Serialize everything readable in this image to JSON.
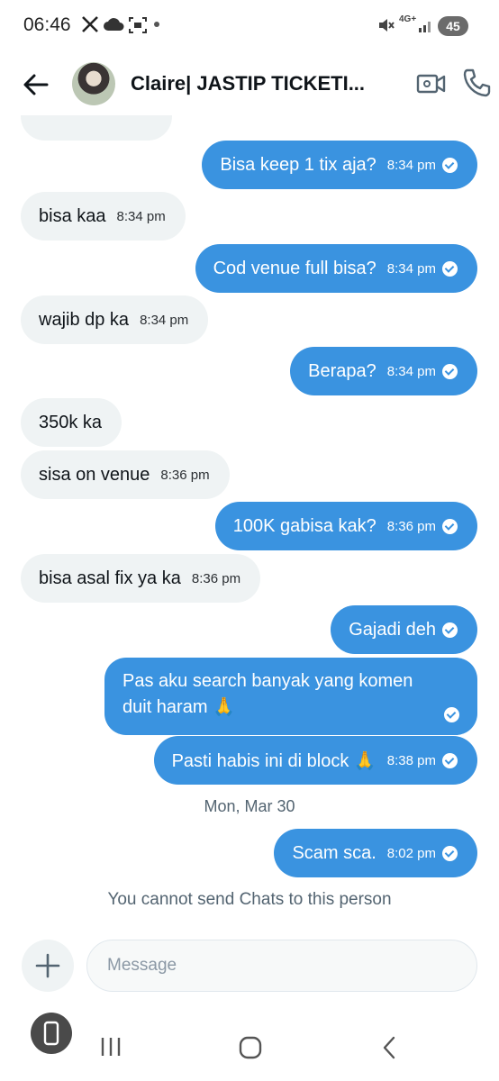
{
  "status_bar": {
    "time": "06:46",
    "battery": "45",
    "network": "4G+"
  },
  "header": {
    "title": "Claire| JASTIP TICKETI..."
  },
  "messages": [
    {
      "text": "Bisa keep 1 tix aja?",
      "time": "8:34 pm",
      "direction": "out"
    },
    {
      "text": "bisa kaa",
      "time": "8:34 pm",
      "direction": "in"
    },
    {
      "text": "Cod venue full bisa?",
      "time": "8:34 pm",
      "direction": "out"
    },
    {
      "text": "wajib dp ka",
      "time": "8:34 pm",
      "direction": "in"
    },
    {
      "text": "Berapa?",
      "time": "8:34 pm",
      "direction": "out"
    },
    {
      "text": "350k ka",
      "time": "",
      "direction": "in"
    },
    {
      "text": "sisa on venue",
      "time": "8:36 pm",
      "direction": "in"
    },
    {
      "text": "100K gabisa kak?",
      "time": "8:36 pm",
      "direction": "out"
    },
    {
      "text": "bisa asal fix ya ka",
      "time": "8:36 pm",
      "direction": "in"
    },
    {
      "text": "Gajadi deh",
      "time": "",
      "direction": "out"
    },
    {
      "text": "Pas aku search banyak yang komen duit haram 🙏",
      "time": "",
      "direction": "out"
    },
    {
      "text": "Pasti habis ini di block 🙏",
      "time": "8:38 pm",
      "direction": "out"
    },
    {
      "text": "Scam sca.",
      "time": "8:02 pm",
      "direction": "out"
    }
  ],
  "date_separator": "Mon, Mar 30",
  "notice": "You cannot send Chats to this person",
  "composer": {
    "placeholder": "Message"
  },
  "colors": {
    "outgoing_bubble": "#3a93e0",
    "incoming_bubble": "#eff3f4",
    "secondary_text": "#536471"
  }
}
